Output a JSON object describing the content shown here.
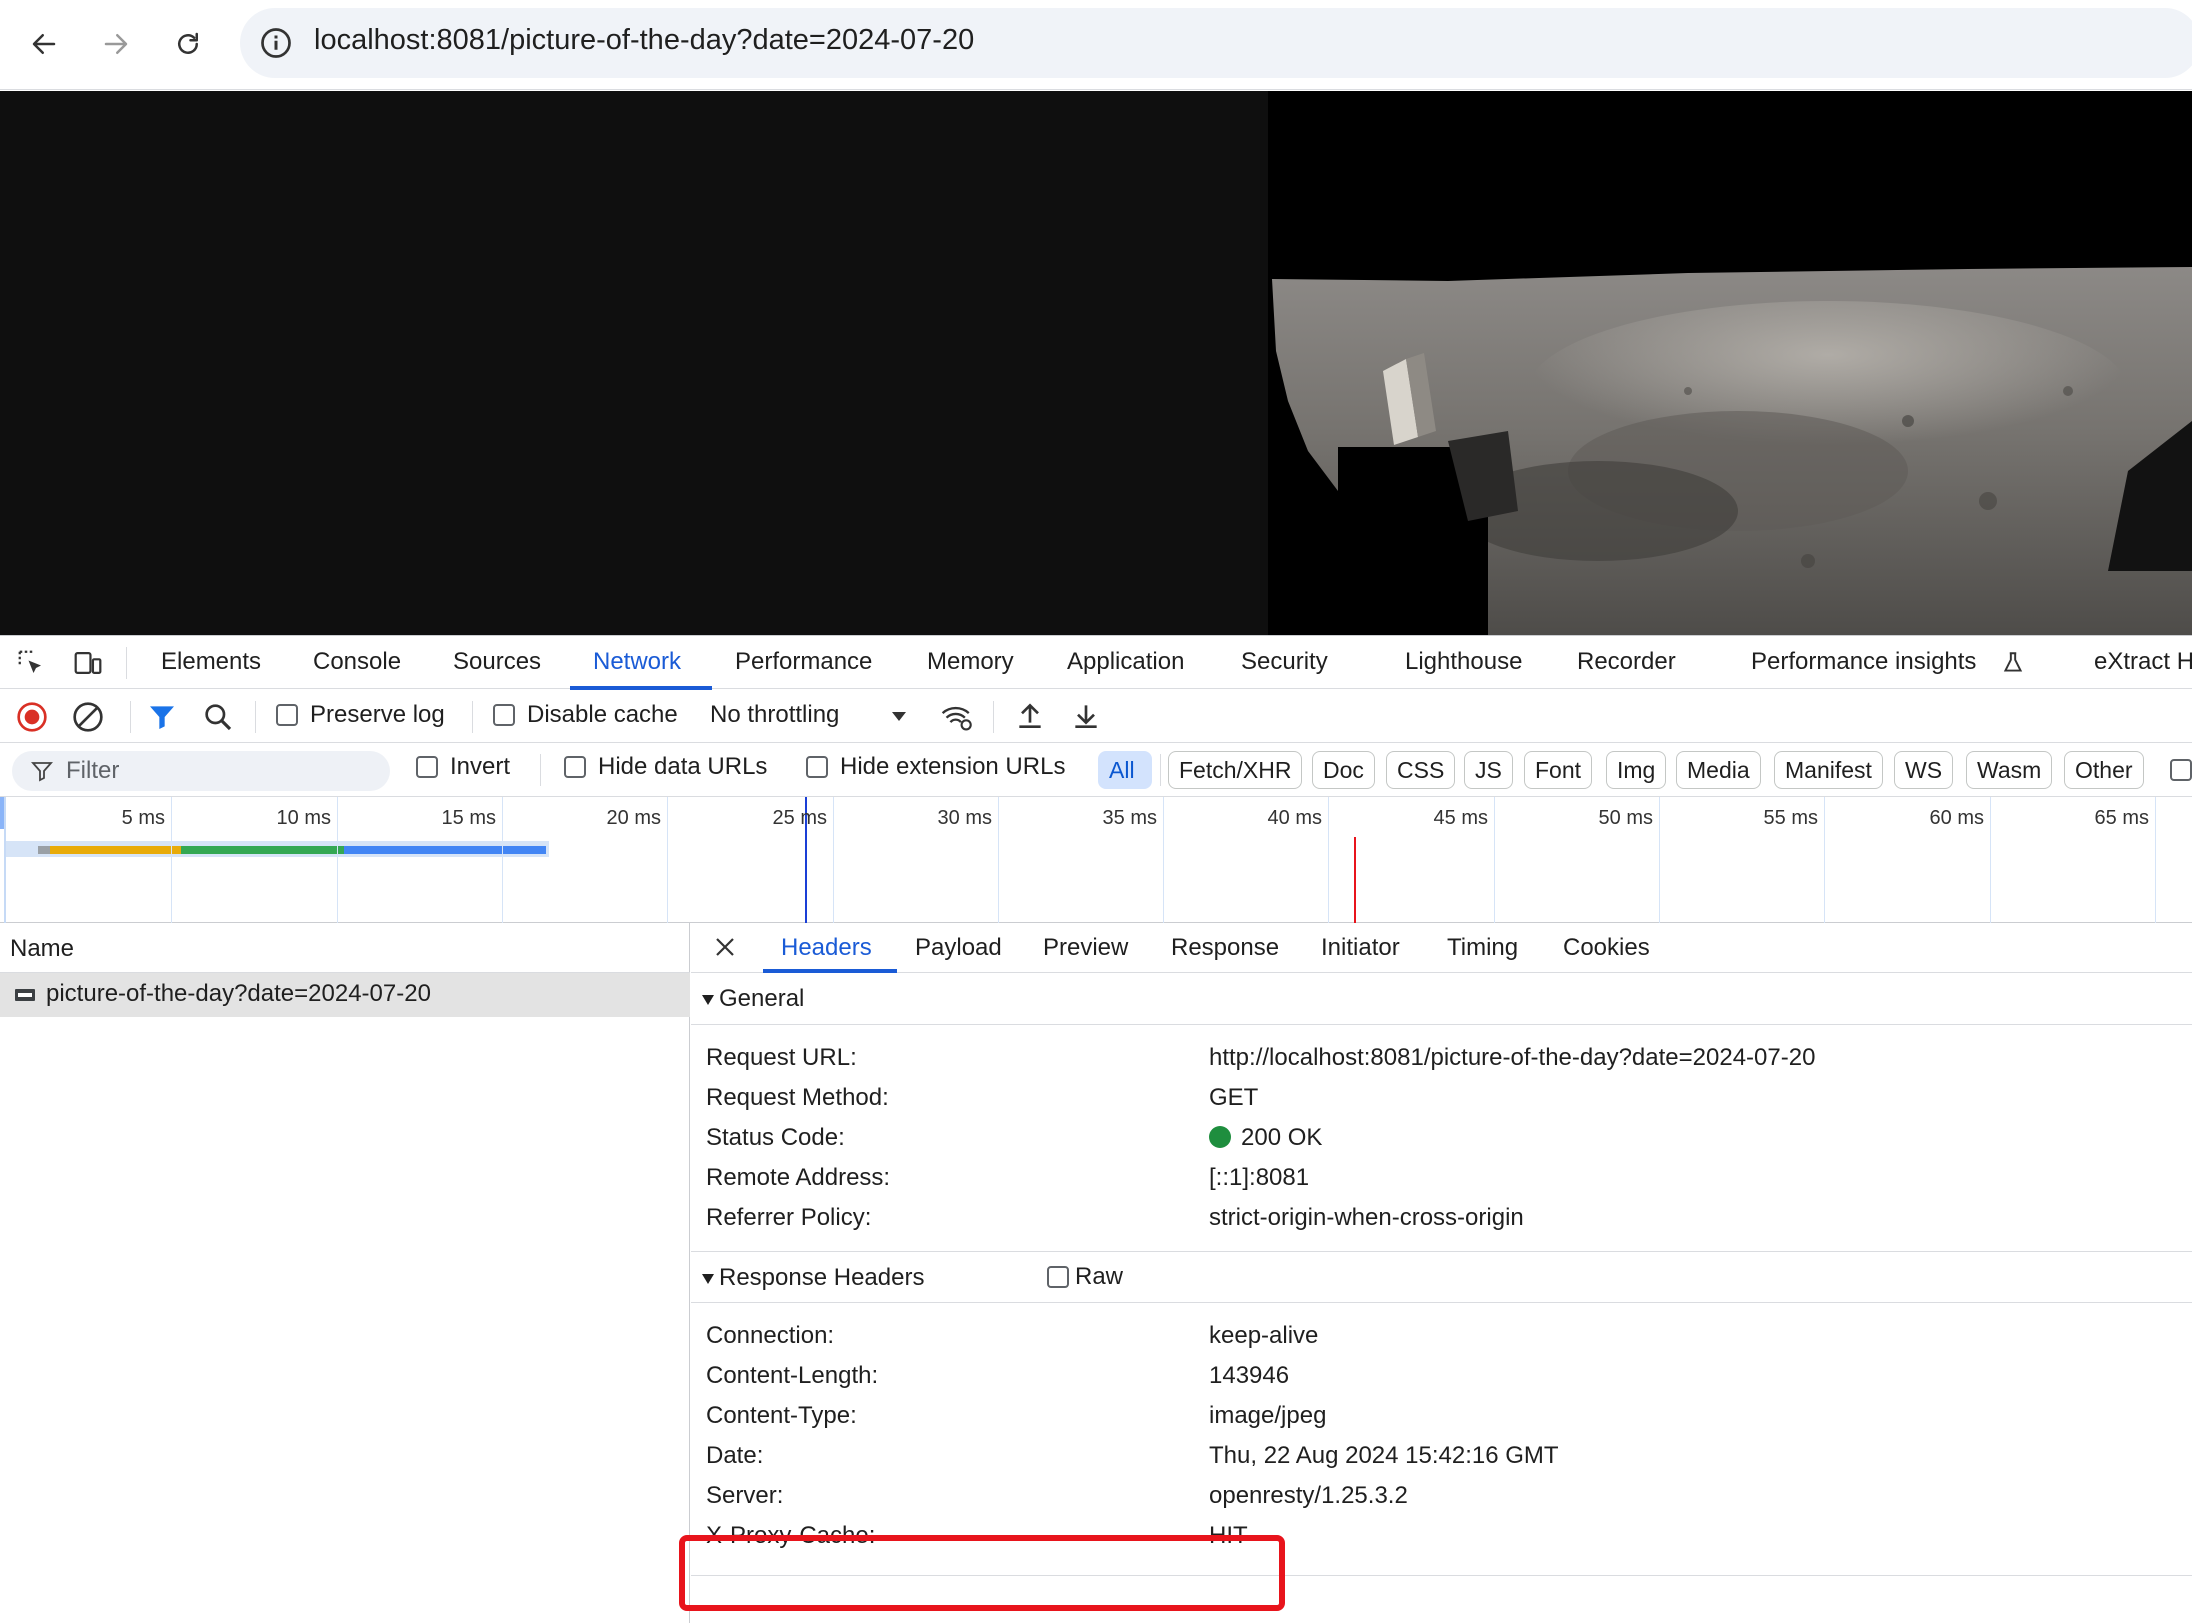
{
  "browser": {
    "url": "localhost:8081/picture-of-the-day?date=2024-07-20"
  },
  "devtools": {
    "tabs": [
      "Elements",
      "Console",
      "Sources",
      "Network",
      "Performance",
      "Memory",
      "Application",
      "Security",
      "Lighthouse",
      "Recorder",
      "Performance insights",
      "eXtract H"
    ],
    "active_tab": "Network",
    "toolbar": {
      "preserve_log": "Preserve log",
      "disable_cache": "Disable cache",
      "throttling": "No throttling"
    },
    "filter": {
      "placeholder": "Filter",
      "invert": "Invert",
      "hide_data_urls": "Hide data URLs",
      "hide_extension_urls": "Hide extension URLs",
      "types": [
        "All",
        "Fetch/XHR",
        "Doc",
        "CSS",
        "JS",
        "Font",
        "Img",
        "Media",
        "Manifest",
        "WS",
        "Wasm",
        "Other"
      ],
      "selected_type": "All"
    },
    "timeline": {
      "ticks": [
        "5 ms",
        "10 ms",
        "15 ms",
        "20 ms",
        "25 ms",
        "30 ms",
        "35 ms",
        "40 ms",
        "45 ms",
        "50 ms",
        "55 ms",
        "60 ms",
        "65 ms"
      ]
    },
    "requests": {
      "column": "Name",
      "rows": [
        "picture-of-the-day?date=2024-07-20"
      ]
    },
    "detail": {
      "tabs": [
        "Headers",
        "Payload",
        "Preview",
        "Response",
        "Initiator",
        "Timing",
        "Cookies"
      ],
      "active_tab": "Headers",
      "general": {
        "title": "General",
        "rows": [
          {
            "key": "Request URL:",
            "value": "http://localhost:8081/picture-of-the-day?date=2024-07-20"
          },
          {
            "key": "Request Method:",
            "value": "GET"
          },
          {
            "key": "Status Code:",
            "value": "200 OK"
          },
          {
            "key": "Remote Address:",
            "value": "[::1]:8081"
          },
          {
            "key": "Referrer Policy:",
            "value": "strict-origin-when-cross-origin"
          }
        ]
      },
      "response_headers": {
        "title": "Response Headers",
        "raw_label": "Raw",
        "rows": [
          {
            "key": "Connection:",
            "value": "keep-alive"
          },
          {
            "key": "Content-Length:",
            "value": "143946"
          },
          {
            "key": "Content-Type:",
            "value": "image/jpeg"
          },
          {
            "key": "Date:",
            "value": "Thu, 22 Aug 2024 15:42:16 GMT"
          },
          {
            "key": "Server:",
            "value": "openresty/1.25.3.2"
          },
          {
            "key": "X-Proxy-Cache:",
            "value": "HIT"
          }
        ]
      }
    }
  },
  "colors": {
    "accent": "#1a5bd6",
    "status_ok": "#1e8e3e",
    "highlight": "#e8141c"
  }
}
